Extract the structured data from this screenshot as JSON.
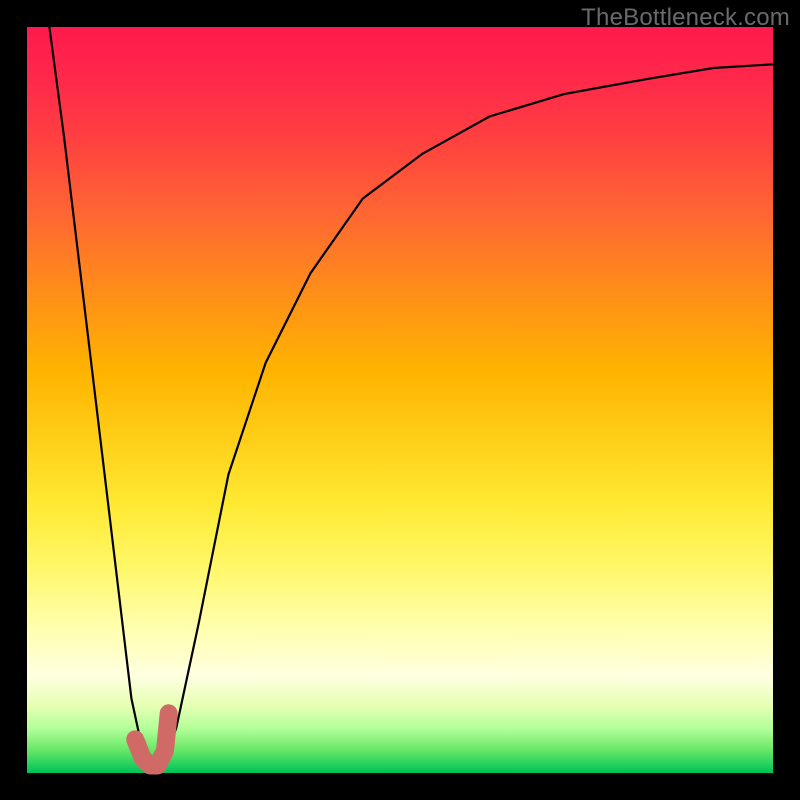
{
  "watermark": "TheBottleneck.com",
  "chart_data": {
    "type": "line",
    "title": "",
    "xlabel": "",
    "ylabel": "",
    "xlim": [
      0,
      100
    ],
    "ylim": [
      0,
      100
    ],
    "series": [
      {
        "name": "bottleneck-curve",
        "x": [
          3,
          5,
          8,
          11,
          14,
          15.5,
          17,
          18.5,
          20,
          23,
          27,
          32,
          38,
          45,
          53,
          62,
          72,
          83,
          92,
          100
        ],
        "y": [
          100,
          85,
          60,
          35,
          10,
          3,
          1,
          2,
          6,
          20,
          40,
          55,
          67,
          77,
          83,
          88,
          91,
          93,
          94.5,
          95
        ]
      }
    ],
    "marker": {
      "x": 15.0,
      "y": 4
    },
    "hook": {
      "path_x": [
        14.5,
        15.5,
        16.5,
        17.5,
        18.5,
        19.0
      ],
      "path_y": [
        4.5,
        2.0,
        1.0,
        1.0,
        3.0,
        8.0
      ]
    },
    "colors": {
      "curve": "#000000",
      "marker": "#d06a66",
      "hook": "#d06a66"
    }
  }
}
